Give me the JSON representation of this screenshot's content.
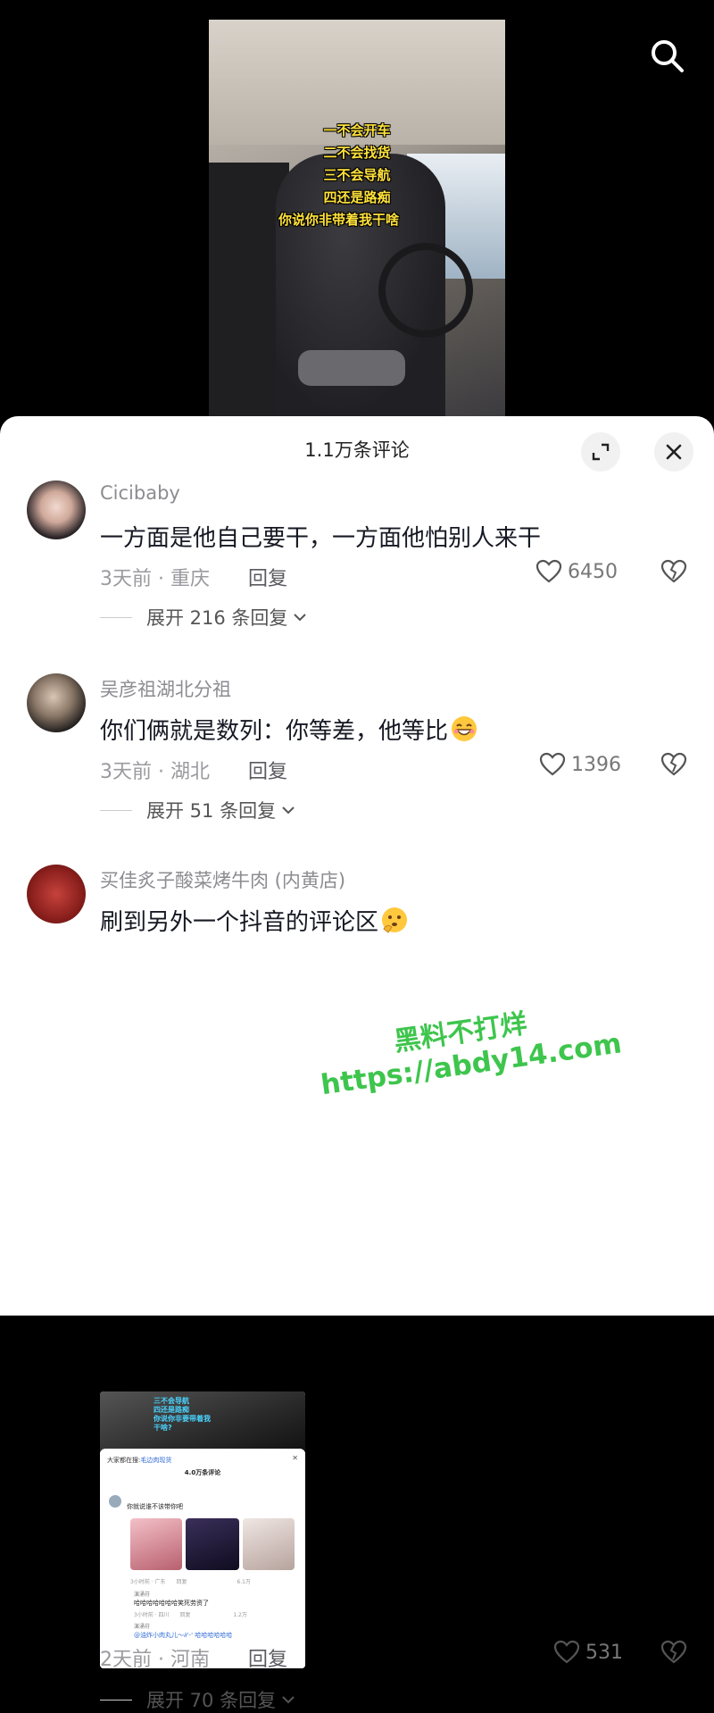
{
  "video": {
    "captions": [
      "一不会开车",
      "二不会找货",
      "三不会导航",
      "四还是路痴",
      "你说你非带着我干啥"
    ]
  },
  "panel": {
    "title": "1.1万条评论"
  },
  "comments": [
    {
      "username": "Cicibaby",
      "text": "一方面是他自己要干，一方面他怕别人来干",
      "meta": "3天前 · 重庆",
      "reply_label": "回复",
      "likes": "6450",
      "expand": "展开 216 条回复"
    },
    {
      "username": "吴彦祖湖北分祖",
      "text": "你们俩就是数列：你等差，他等比",
      "meta": "3天前 · 湖北",
      "reply_label": "回复",
      "likes": "1396",
      "expand": "展开 51 条回复"
    },
    {
      "username": "买佳炙子酸菜烤牛肉 (内黄店)",
      "text": "刷到另外一个抖音的评论区",
      "meta": "2天前 · 河南",
      "reply_label": "回复",
      "likes": "531",
      "expand": "展开 70 条回复"
    }
  ],
  "embedded_screenshot": {
    "caption_lines": [
      "三不会导航",
      "四还是路痴",
      "你说你非要带着我",
      "干啥?"
    ],
    "search_prefix": "大家都在搜:",
    "search_term": "毛边肉现货",
    "title": "4.0万条评论",
    "comment1_text": "你就说谁不该带你吧",
    "comment1_meta": "3小时前 · 广东",
    "comment1_reply": "回复",
    "comment1_likes": "6.1万",
    "reply1_user": "演涌苻",
    "reply1_text": "哈哈哈哈哈哈哈笑死劳资了",
    "reply1_meta": "3小时前 · 四川",
    "reply1_reply": "回复",
    "reply1_likes": "1.2万",
    "reply2_user": "演涌苻",
    "reply2_text": "@油炸小肉丸儿～∂'-' 哈哈哈哈哈哈"
  },
  "watermark": {
    "line1": "黑料不打烊",
    "line2": "https://abdy14.com"
  },
  "icons": {
    "search": "search-icon",
    "expand": "expand-icon",
    "close": "close-icon",
    "heart": "heart-icon",
    "dislike": "broken-heart-icon",
    "chevron": "chevron-down-icon"
  },
  "colors": {
    "watermark": "#3ec54d",
    "caption": "#ffe23a"
  }
}
